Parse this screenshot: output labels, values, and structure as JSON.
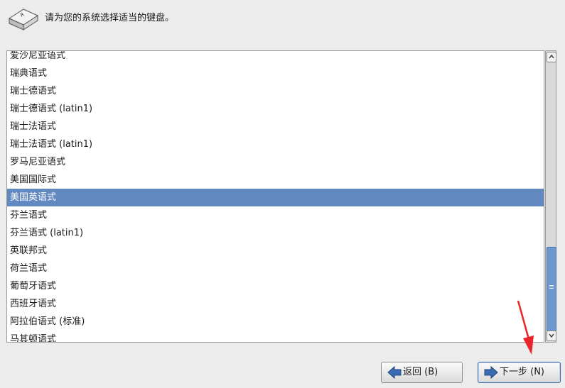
{
  "header": {
    "text": "请为您的系统选择适当的键盘。",
    "icon": "keyboard-key-icon"
  },
  "keyboard_list": {
    "items": [
      {
        "label": "爱沙尼亚语式",
        "selected": false
      },
      {
        "label": "瑞典语式",
        "selected": false
      },
      {
        "label": "瑞士德语式",
        "selected": false
      },
      {
        "label": "瑞士德语式 (latin1)",
        "selected": false
      },
      {
        "label": "瑞士法语式",
        "selected": false
      },
      {
        "label": "瑞士法语式 (latin1)",
        "selected": false
      },
      {
        "label": "罗马尼亚语式",
        "selected": false
      },
      {
        "label": "美国国际式",
        "selected": false
      },
      {
        "label": "美国英语式",
        "selected": true
      },
      {
        "label": "芬兰语式",
        "selected": false
      },
      {
        "label": "芬兰语式 (latin1)",
        "selected": false
      },
      {
        "label": "英联邦式",
        "selected": false
      },
      {
        "label": "荷兰语式",
        "selected": false
      },
      {
        "label": "葡萄牙语式",
        "selected": false
      },
      {
        "label": "西班牙语式",
        "selected": false
      },
      {
        "label": "阿拉伯语式 (标准)",
        "selected": false
      },
      {
        "label": "马其顿语式",
        "selected": false
      }
    ],
    "selected_color": "#6189bf"
  },
  "buttons": {
    "back_label": "返回 (B)",
    "next_label": "下一步 (N)"
  },
  "colors": {
    "background": "#ececec",
    "scroll_thumb": "#6e97cf",
    "arrow_icon": "#3b6bb3",
    "annotation_arrow": "#e8262b"
  }
}
